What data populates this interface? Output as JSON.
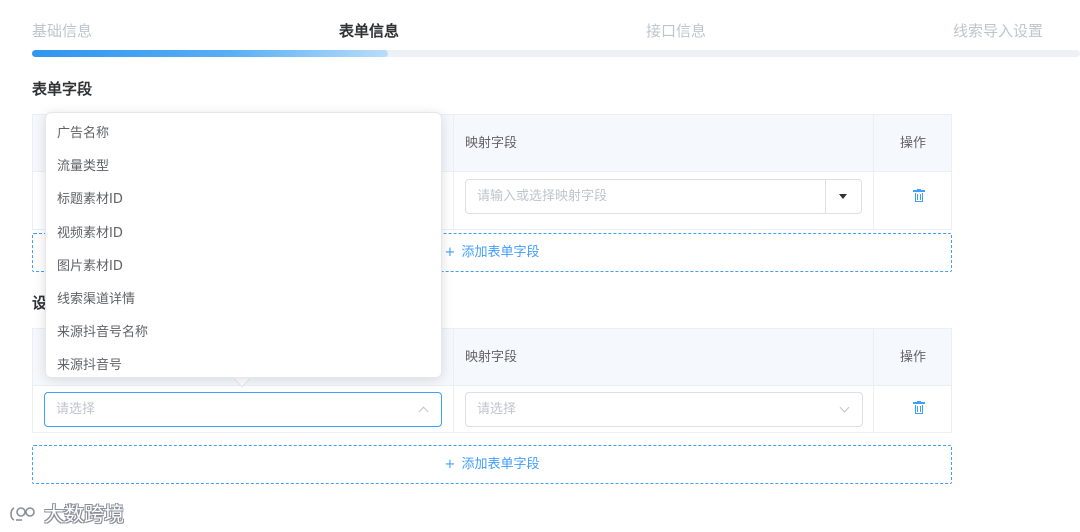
{
  "steps": [
    "基础信息",
    "表单信息",
    "接口信息",
    "线索导入设置"
  ],
  "active_step": "表单信息",
  "section1": {
    "title": "表单字段",
    "columns": {
      "mapping": "映射字段",
      "action": "操作"
    },
    "row": {
      "mapping_placeholder": "请输入或选择映射字段"
    },
    "add_label": "添加表单字段"
  },
  "section2": {
    "title_fragment": "设",
    "columns": {
      "mapping": "映射字段",
      "action": "操作"
    },
    "row": {
      "field_placeholder": "请选择",
      "mapping_placeholder": "请选择"
    },
    "add_label": "添加表单字段"
  },
  "dropdown_options": [
    "广告名称",
    "流量类型",
    "标题素材ID",
    "视频素材ID",
    "图片素材ID",
    "线索渠道详情",
    "来源抖音号名称",
    "来源抖音号"
  ],
  "icons": {
    "delete": "trash-icon",
    "plus": "plus-icon",
    "dropdown": "caret-down-icon",
    "chevron": "chevron-icon"
  },
  "colors": {
    "accent": "#409eff",
    "header_bg": "#f5f8fc"
  },
  "watermark": "大数跨境"
}
